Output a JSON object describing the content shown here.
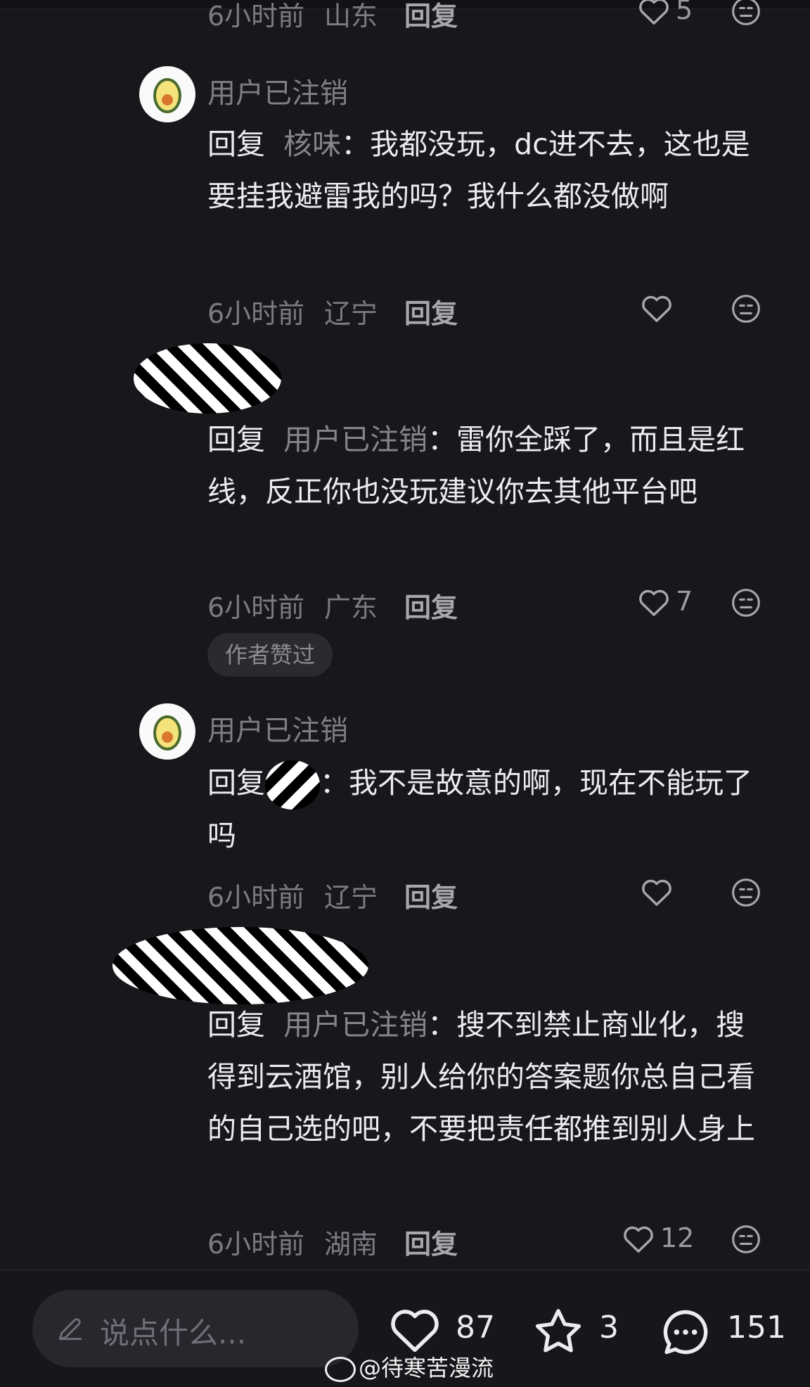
{
  "comments": [
    {
      "username": "",
      "reply_prefix": "",
      "reply_target": "",
      "text": "",
      "time": "6小时前",
      "location": "山东",
      "reply_label": "回复",
      "likes": "5"
    },
    {
      "username": "用户已注销",
      "reply_prefix": "回复",
      "reply_target": "核味",
      "text": "我都没玩，dc进不去，这也是要挂我避雷我的吗？我什么都没做啊",
      "time": "6小时前",
      "location": "辽宁",
      "reply_label": "回复",
      "likes": ""
    },
    {
      "username": "",
      "reply_prefix": "回复",
      "reply_target": "用户已注销",
      "text": "雷你全踩了，而且是红线，反正你也没玩建议你去其他平台吧",
      "time": "6小时前",
      "location": "广东",
      "reply_label": "回复",
      "likes": "7",
      "badge": "作者赞过"
    },
    {
      "username": "用户已注销",
      "reply_prefix": "回复",
      "reply_target": "",
      "text": "我不是故意的啊，现在不能玩了吗",
      "time": "6小时前",
      "location": "辽宁",
      "reply_label": "回复",
      "likes": ""
    },
    {
      "username": "",
      "reply_prefix": "回复",
      "reply_target": "用户已注销",
      "text": "搜不到禁止商业化，搜得到云酒馆，别人给你的答案题你总自己看的自己选的吧，不要把责任都推到别人身上",
      "time": "6小时前",
      "location": "湖南",
      "reply_label": "回复",
      "likes": "12"
    }
  ],
  "bottom_bar": {
    "input_placeholder": "说点什么...",
    "likes": "87",
    "favorites": "3",
    "comments": "151"
  },
  "watermark": "@待寒苦漫流",
  "icons": {
    "like": "heart-outline-icon",
    "dislike": "meh-face-icon",
    "edit": "pencil-icon",
    "favorite": "star-icon",
    "comment": "speech-bubble-icon",
    "avatar": "avocado-icon",
    "weibo": "weibo-logo-icon"
  },
  "colors": {
    "background": "#17171c",
    "text": "#ececf0",
    "muted": "#7b7b83"
  }
}
